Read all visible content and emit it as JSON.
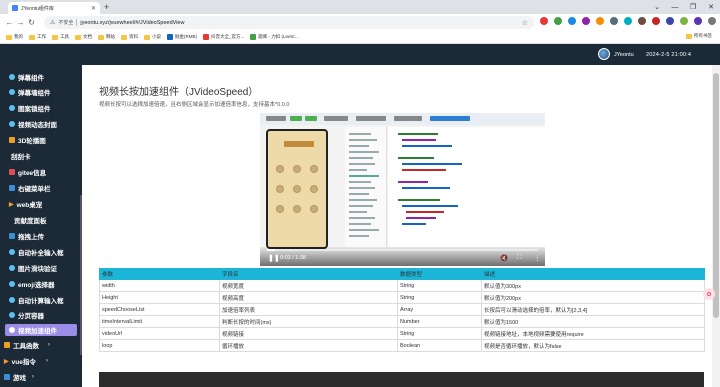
{
  "browser": {
    "tab_title": "JYeontu组件库",
    "window_controls": [
      "chevron-down-icon",
      "minimize-icon",
      "restore-icon",
      "close-icon"
    ],
    "security_text": "不安全",
    "url": "jyeontu.xyz/jvuewheel/#/JVideoSpeedView",
    "bookmarks": [
      "我的",
      "工作",
      "工具",
      "文档",
      "网站",
      "资料",
      "小说",
      "掘金(RMB)",
      "抖音大全_官方...",
      "题库 - 力扣 (LeetC..."
    ],
    "bookmarks_right": "所有书签"
  },
  "header": {
    "username": "JYeontu",
    "datetime": "2024-2-5 21:00:4"
  },
  "sidebar": {
    "items": [
      {
        "label": "弹幕组件"
      },
      {
        "label": "弹幕墙组件"
      },
      {
        "label": "图案锁组件"
      },
      {
        "label": "视频动态封面"
      },
      {
        "label": "3D轮播图"
      },
      {
        "label": "刮刮卡"
      },
      {
        "label": "gitee信息"
      },
      {
        "label": "右键菜单栏"
      },
      {
        "label": "web桌宠"
      },
      {
        "label": "贡献度面板"
      },
      {
        "label": "拖拽上传"
      },
      {
        "label": "自动补全输入框"
      },
      {
        "label": "图片滑块验证"
      },
      {
        "label": "emoji选择器"
      },
      {
        "label": "自动计算输入框"
      },
      {
        "label": "分页容器"
      },
      {
        "label": "视频加速组件"
      },
      {
        "label": "工具函数"
      },
      {
        "label": "vue指令"
      },
      {
        "label": "游戏"
      }
    ],
    "active_index": 16
  },
  "main": {
    "title": "视频长按加速组件（JVideoSpeed）",
    "description": "视频长按可以选择加速倍速，且右侧区域会显示加速倍率信息，支持基本*0.0.0",
    "video": {
      "time": "0:03 / 1:38",
      "progress": 0.03
    },
    "table": {
      "headers": [
        "参数",
        "字段名",
        "数据类型",
        "描述"
      ],
      "rows": [
        [
          "width",
          "视频宽度",
          "String",
          "默认值为300px"
        ],
        [
          "Height",
          "视频高度",
          "String",
          "默认值为200px"
        ],
        [
          "speedChooseList",
          "加速倍率列表",
          "Array",
          "长按后可以滑动选择的倍率，默认为[2,3,4]"
        ],
        [
          "timeIntervalLimit",
          "判断长按的时间(ms)",
          "Number",
          "默认值为1500"
        ],
        [
          "videoUrl",
          "视频链接",
          "String",
          "视频链接地址，本地视频需要使用require"
        ],
        [
          "loop",
          "循环播放",
          "Boolean",
          "视频是否循环播放，默认为false"
        ]
      ]
    }
  },
  "colors": {
    "header_bg": "#1c2a38",
    "active_item": "#9b8ce8",
    "table_header": "#1bb5d8",
    "menu_dot": "#5cc0f0"
  }
}
